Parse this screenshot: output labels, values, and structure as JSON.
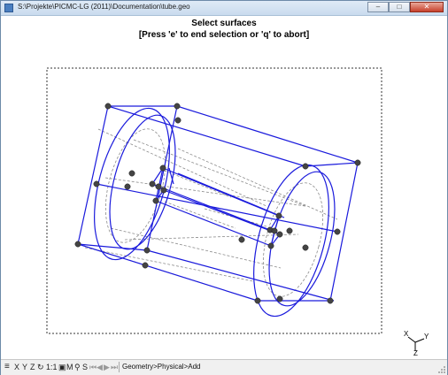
{
  "window": {
    "title": "S:\\Projekte\\PICMC-LG (2011)\\Documentation\\tube.geo",
    "buttons": {
      "minimize": "–",
      "maximize": "□",
      "close": "✕"
    }
  },
  "prompt": {
    "line1": "Select surfaces",
    "line2": "[Press 'e' to end selection or 'q' to abort]"
  },
  "axes": {
    "x": "X",
    "y": "Y",
    "z": "Z"
  },
  "statusbar": {
    "menu_icon": "menu-icon",
    "x": "X",
    "y": "Y",
    "z": "Z",
    "rotate": "↻",
    "scale": "1:1",
    "snapshot": "▣",
    "movie": "M",
    "tool": "⚲",
    "s": "S",
    "nav": [
      "⏮",
      "◀",
      "▶",
      "⏭"
    ],
    "status": "Geometry>Physical>Add"
  },
  "colors": {
    "lines": "#1a1adc",
    "hidden_lines": "#8c8c8c",
    "points": "#444444",
    "title_bar": "#c9dbee"
  }
}
